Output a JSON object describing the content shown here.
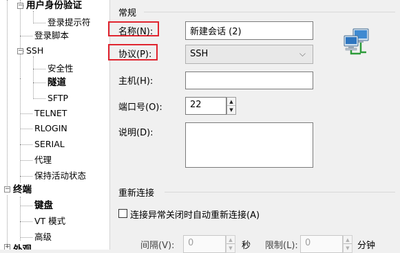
{
  "tree": {
    "items": [
      {
        "label": "用户身份验证"
      },
      {
        "label": "登录提示符"
      },
      {
        "label": "登录脚本"
      },
      {
        "label": "SSH"
      },
      {
        "label": "安全性"
      },
      {
        "label": "隧道"
      },
      {
        "label": "SFTP"
      },
      {
        "label": "TELNET"
      },
      {
        "label": "RLOGIN"
      },
      {
        "label": "SERIAL"
      },
      {
        "label": "代理"
      },
      {
        "label": "保持活动状态"
      },
      {
        "label": "终端"
      },
      {
        "label": "键盘"
      },
      {
        "label": "VT 模式"
      },
      {
        "label": "高级"
      },
      {
        "label": "外观"
      }
    ],
    "expander_minus": "−",
    "expander_plus": "+"
  },
  "general": {
    "section_title": "常规",
    "name_label": "名称(N):",
    "name_value": "新建会话 (2)",
    "protocol_label": "协议(P):",
    "protocol_value": "SSH",
    "host_label": "主机(H):",
    "host_value": "",
    "port_label": "端口号(O):",
    "port_value": "22",
    "desc_label": "说明(D):",
    "desc_value": "",
    "network_icon": "network-computers-icon",
    "highlight_color": "#e0242f"
  },
  "reconnect": {
    "section_title": "重新连接",
    "checkbox_label": "连接异常关闭时自动重新连接(A)",
    "checked": false,
    "interval_label": "间隔(V):",
    "interval_value": "0",
    "seconds_label": "秒",
    "limit_label": "限制(L):",
    "limit_value": "0",
    "minutes_label": "分钟"
  }
}
